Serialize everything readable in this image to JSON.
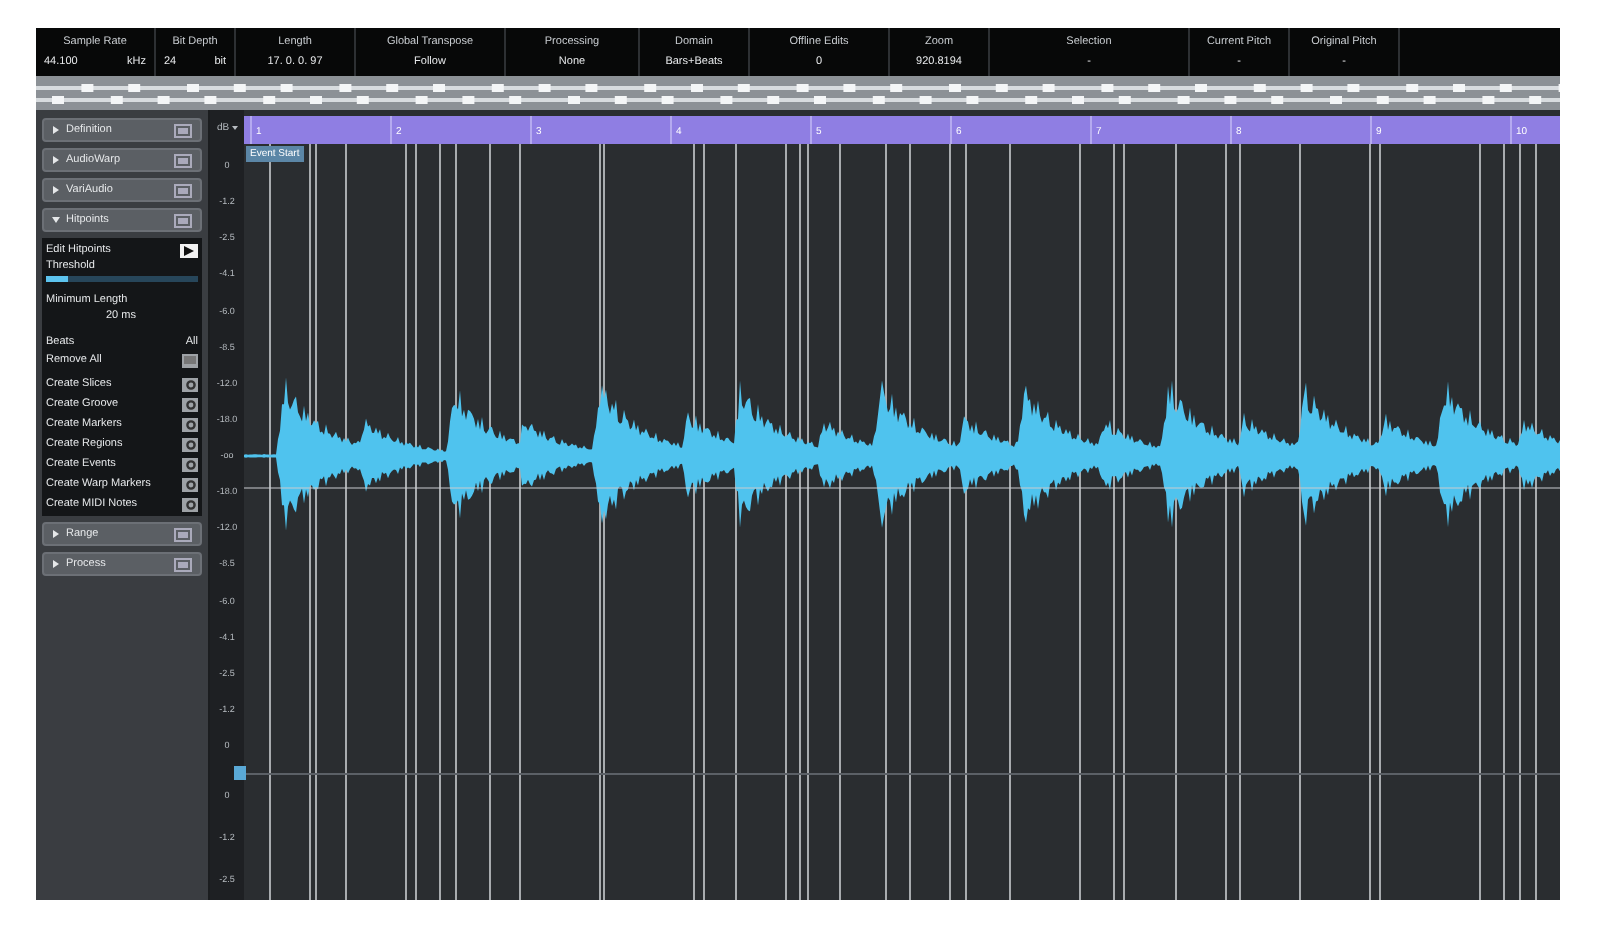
{
  "info_bar": [
    {
      "label": "Sample Rate",
      "value": "44.100",
      "unit": "kHz"
    },
    {
      "label": "Bit Depth",
      "value": "24",
      "unit": "bit"
    },
    {
      "label": "Length",
      "value": "17. 0. 0. 97"
    },
    {
      "label": "Global Transpose",
      "value": "Follow"
    },
    {
      "label": "Processing",
      "value": "None"
    },
    {
      "label": "Domain",
      "value": "Bars+Beats"
    },
    {
      "label": "Offline Edits",
      "value": "0"
    },
    {
      "label": "Zoom",
      "value": "920.8194"
    },
    {
      "label": "Selection",
      "value": "-"
    },
    {
      "label": "Current Pitch",
      "value": "-"
    },
    {
      "label": "Original Pitch",
      "value": "-"
    }
  ],
  "inspector": {
    "sections": [
      {
        "title": "Definition",
        "expanded": false
      },
      {
        "title": "AudioWarp",
        "expanded": false
      },
      {
        "title": "VariAudio",
        "expanded": false
      },
      {
        "title": "Hitpoints",
        "expanded": true,
        "content": {
          "edit_hitpoints": "Edit Hitpoints",
          "threshold": {
            "label": "Threshold",
            "level": 0.15
          },
          "minimum_length": {
            "label": "Minimum Length",
            "value": "20 ms"
          },
          "beats": {
            "label": "Beats",
            "value": "All"
          },
          "remove_all": "Remove All",
          "create_actions": [
            "Create Slices",
            "Create Groove",
            "Create Markers",
            "Create Regions",
            "Create Events",
            "Create Warp Markers",
            "Create MIDI Notes"
          ]
        }
      },
      {
        "title": "Range",
        "expanded": false
      },
      {
        "title": "Process",
        "expanded": false
      }
    ]
  },
  "scale": {
    "unit": "dB",
    "channel_1": [
      "0",
      "-1.2",
      "-2.5",
      "-4.1",
      "-6.0",
      "-8.5",
      "-12.0",
      "-18.0",
      "-oo",
      "-18.0",
      "-12.0",
      "-8.5",
      "-6.0",
      "-4.1",
      "-2.5",
      "-1.2",
      "0"
    ],
    "channel_2": [
      "0",
      "-1.2",
      "-2.5"
    ]
  },
  "ruler": {
    "bars": [
      "1",
      "2",
      "3",
      "4",
      "5",
      "6",
      "7",
      "8",
      "9",
      "10"
    ]
  },
  "event_start": "Event Start"
}
